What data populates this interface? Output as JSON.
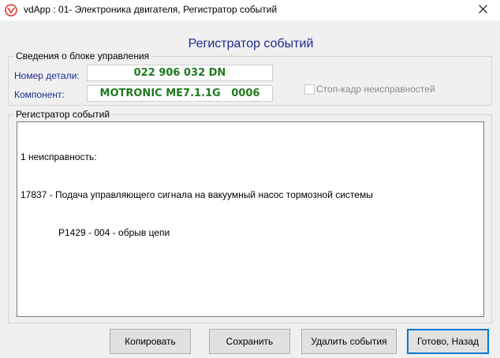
{
  "window": {
    "title": "vdApp : 01- Электроника двигателя,  Регистратор событий",
    "app_icon": "vag-logo-icon",
    "close_icon": "close-icon"
  },
  "dialog": {
    "heading": "Регистратор событий"
  },
  "control_unit": {
    "legend": "Сведения о блоке управления",
    "part_number_label": "Номер детали:",
    "part_number_value": "022 906 032 DN",
    "component_label": "Компонент:",
    "component_value": "MOTRONIC ME7.1.1G   0006",
    "freeze_frame_label": "Стоп-кадр неисправностей",
    "freeze_frame_checked": false
  },
  "event_log": {
    "legend": "Регистратор событий",
    "lines": [
      "1 неисправность:",
      "17837 - Подача управляющего сигнала на вакуумный насос тормозной системы",
      "P1429 - 004 - обрыв цепи"
    ]
  },
  "buttons": {
    "copy": "Копировать",
    "save": "Сохранить",
    "delete_events": "Удалить события",
    "done_back": "Готово, Назад"
  },
  "colors": {
    "heading_blue": "#1b2b8f",
    "value_green": "#1f7a1f",
    "default_button_border": "#0078d7"
  }
}
